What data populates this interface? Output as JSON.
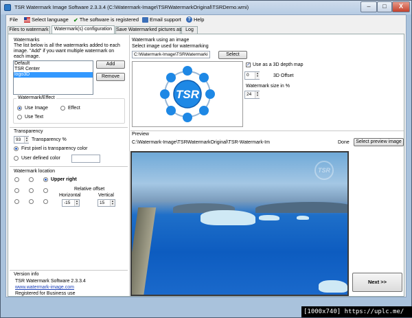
{
  "window": {
    "title": "TSR Watermark Image Software 2.3.3.4 (C:\\Watermark-Image\\TSRWatermarkOriginal\\TSRDemo.wmi)",
    "minimize": "–",
    "maximize": "□",
    "close": "X"
  },
  "menu": {
    "file": "File",
    "language": "Select language",
    "registered": "The software is registered",
    "support": "Email support",
    "help": "Help"
  },
  "tabs": [
    "Files to watermark",
    "Watermark(s) configuration",
    "Save Watermarked pictures as",
    "Log"
  ],
  "watermarks": {
    "title": "Watermarks",
    "description": "The list below is all the watermarks added to each image. \"Add\" if you want multiple watermark on each image.",
    "items": [
      "Default",
      "TSR Center",
      "logo3D"
    ],
    "selected": "logo3D",
    "add": "Add",
    "remove": "Remove"
  },
  "effect": {
    "title": "Watermark/Effect",
    "use_image": "Use Image",
    "effect": "Effect",
    "use_text": "Use Text"
  },
  "transparency": {
    "title": "Transparency",
    "value": "93",
    "label": "Transparency %",
    "first_pixel": "First pixel is transparency color",
    "user_defined": "User defined color"
  },
  "location": {
    "title": "Watermark location",
    "selected": "Upper right",
    "relative_offset": "Relative offset",
    "horizontal": "Horizontal",
    "vertical": "Vertical",
    "horizontal_value": "-15",
    "vertical_value": "15"
  },
  "version": {
    "title": "Version info",
    "software": "TSR Watermark Software 2.3.3.4",
    "url": "www.watermark-image.com",
    "registered_for": "Registered for Business use"
  },
  "image_watermark": {
    "title": "Watermark using an image",
    "select_label": "Select image used for watermarking",
    "path": "C:\\Watermark-Image\\TSRWatermarki",
    "select_button": "Select",
    "logo_text": "TSR",
    "depth_map": "Use as a 3D depth map",
    "offset_value": "0",
    "offset_label": "3D Offset",
    "size_label": "Watermark size in %",
    "size_value": "24"
  },
  "preview": {
    "title": "Preview",
    "path": "C:\\Watermark-Image\\TSRWatermarkOriginal\\TSR-Watermark-Im",
    "status": "Done",
    "select_button": "Select preview image",
    "overlay_text": "TSR"
  },
  "next_button": "Next >>",
  "overlay": {
    "resolution": "[1000x740]",
    "url": "https://uplc.me/"
  },
  "colors": {
    "accent": "#2a6fdb",
    "selection": "#3399ff",
    "logo_blue": "#1e88e5"
  }
}
